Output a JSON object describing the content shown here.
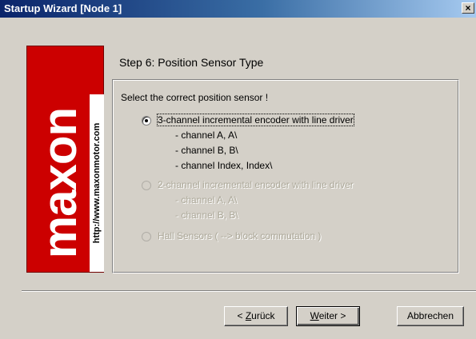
{
  "window": {
    "title": "Startup Wizard  [Node 1]",
    "close_glyph": "×"
  },
  "logo": {
    "brand": "maxon",
    "url": "http://www.maxonmotor.com"
  },
  "step": {
    "title": "Step 6: Position Sensor Type"
  },
  "group": {
    "prompt": "Select the correct position sensor !",
    "options": [
      {
        "label": "3-channel incremental encoder with line driver",
        "selected": true,
        "enabled": true,
        "details": [
          "- channel A, A\\",
          "- channel B, B\\",
          "- channel Index, Index\\"
        ]
      },
      {
        "label": "2-channel incremental encoder with line driver",
        "selected": false,
        "enabled": false,
        "details": [
          "- channel A, A\\",
          "- channel B, B\\"
        ]
      },
      {
        "label": "Hall Sensors ( --> block commutation )",
        "selected": false,
        "enabled": false,
        "details": []
      }
    ]
  },
  "buttons": {
    "back": {
      "underline": "Z",
      "rest": "urück",
      "prefix": "< "
    },
    "next": {
      "underline": "W",
      "rest": "eiter",
      "suffix": " >"
    },
    "cancel": "Abbrechen"
  },
  "colors": {
    "title_bar_start": "#0a246a",
    "title_bar_end": "#a6caf0",
    "logo_red": "#cc0000",
    "dialog_face": "#d4d0c8"
  }
}
